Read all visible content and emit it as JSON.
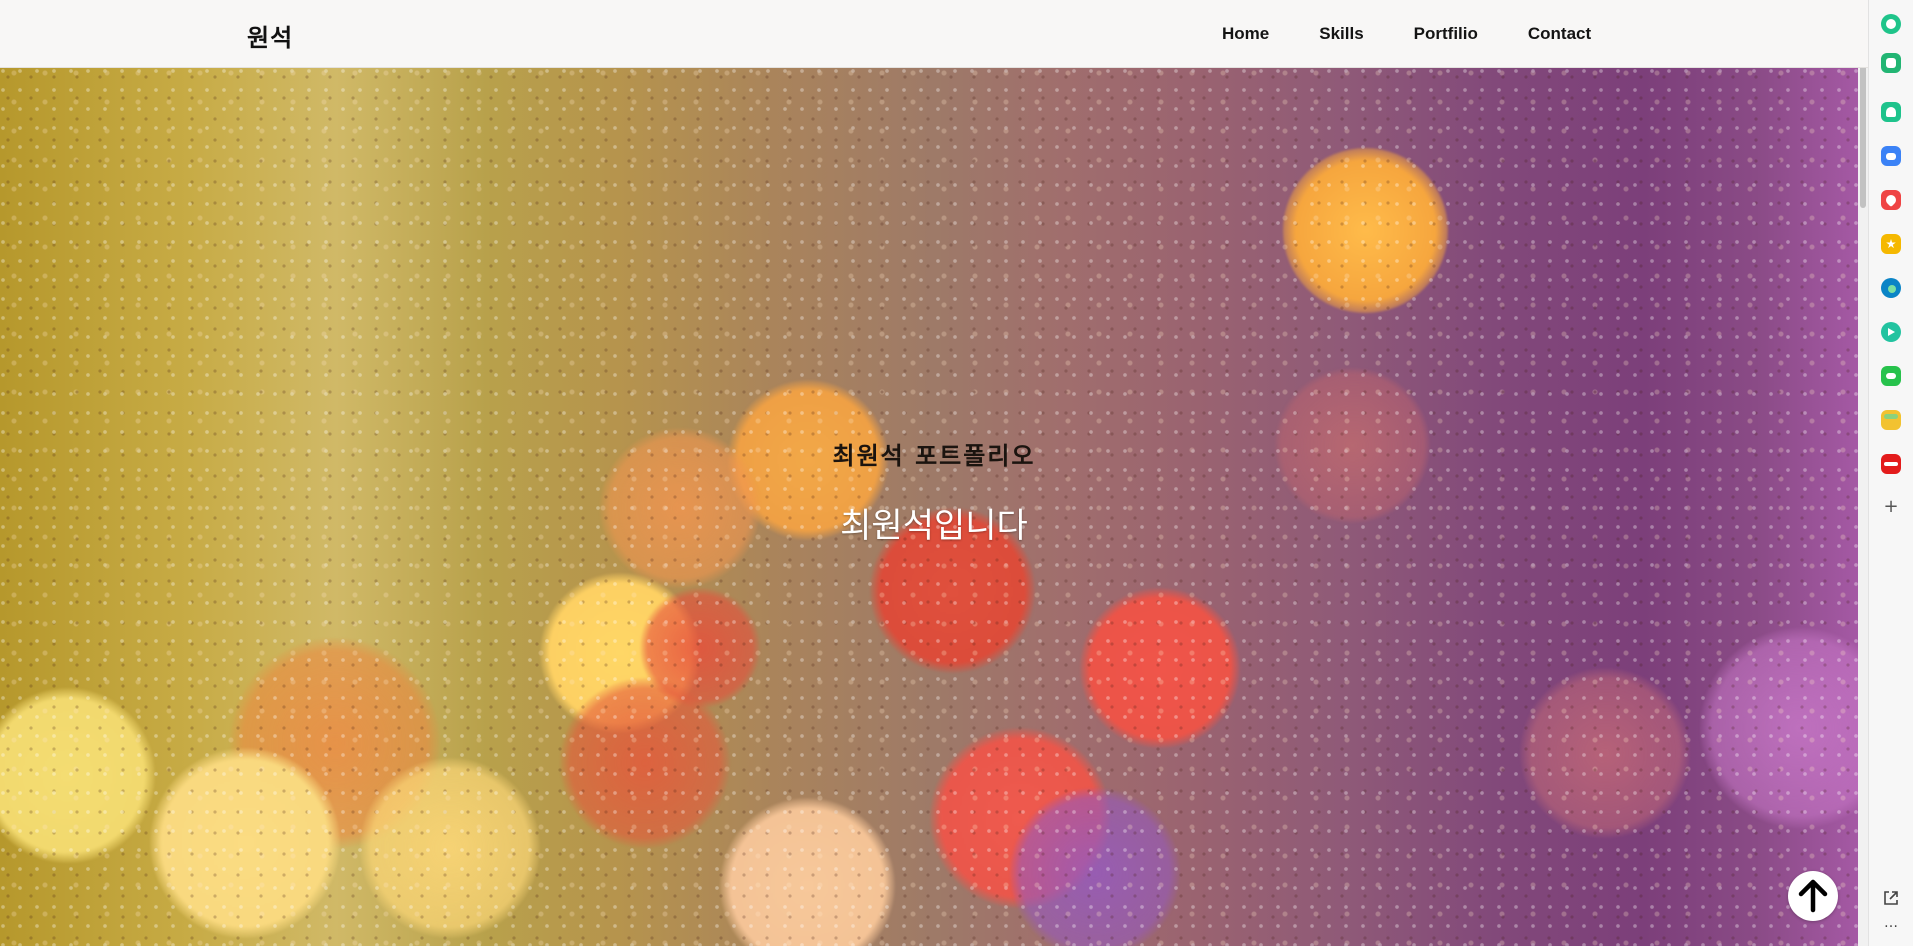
{
  "header": {
    "brand": "원석",
    "nav": [
      "Home",
      "Skills",
      "Portfilio",
      "Contact"
    ]
  },
  "hero": {
    "title": "최원석 포트폴리오",
    "subtitle": "최원석입니다"
  },
  "colors": {
    "header_bg": "#f8f7f6",
    "hero_yellow": "#c7ab45",
    "hero_purple": "#7c3f7a",
    "title_color": "#1b140f",
    "subtitle_color": "#ffffff"
  },
  "sidebar": {
    "icons": [
      {
        "name": "copilot-icon",
        "color": "#1fc48a"
      },
      {
        "name": "notes-icon",
        "color": "#22b573"
      },
      {
        "name": "bell-icon",
        "color": "#1ec38c"
      },
      {
        "name": "briefcase-icon",
        "color": "#3b82f6"
      },
      {
        "name": "heart-icon",
        "color": "#ef4444"
      },
      {
        "name": "star-icon",
        "color": "#f5b800"
      },
      {
        "name": "edge-icon",
        "color": "#0a84c6"
      },
      {
        "name": "play-icon",
        "color": "#22c3a0"
      },
      {
        "name": "game-icon",
        "color": "#27c24c"
      },
      {
        "name": "folder-icon",
        "color": "#f2c230"
      },
      {
        "name": "news-icon",
        "color": "#e31b1b"
      }
    ],
    "add_icon": "plus-icon",
    "bottom_icons": [
      "external-link-icon",
      "more-icon"
    ]
  },
  "scroll_top_icon": "arrow-up-icon"
}
